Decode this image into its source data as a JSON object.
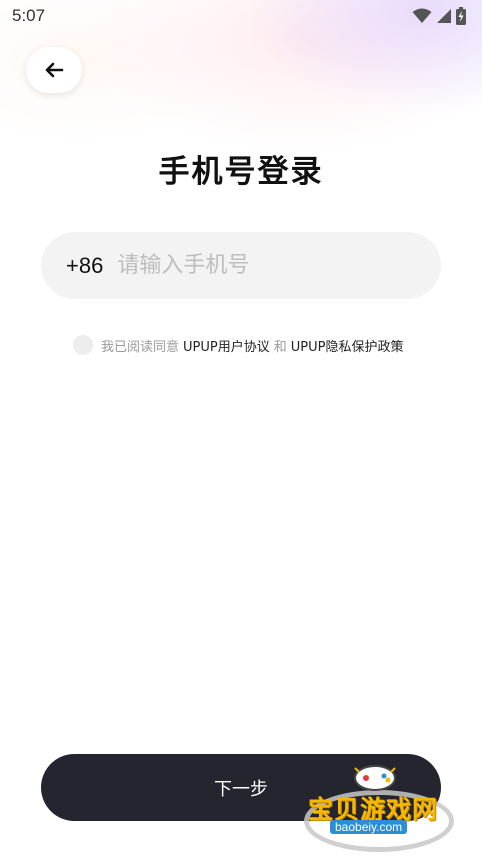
{
  "status_bar": {
    "time": "5:07",
    "icons": [
      "wifi-icon",
      "signal-icon",
      "battery-charging-icon"
    ]
  },
  "header": {
    "back_icon": "arrow-left-icon"
  },
  "login": {
    "title": "手机号登录",
    "country_code": "+86",
    "phone_placeholder": "请输入手机号",
    "phone_value": ""
  },
  "agreement": {
    "checked": false,
    "prefix": "我已阅读同意",
    "user_agreement": "UPUP用户协议",
    "and": "和",
    "privacy_policy": "UPUP隐私保护政策"
  },
  "actions": {
    "next_label": "下一步"
  },
  "watermark": {
    "title": "宝贝游戏网",
    "url": "baobeiy.com"
  },
  "colors": {
    "button_bg": "#25252f",
    "field_bg": "#f3f3f3",
    "muted_text": "#9a9a9a",
    "watermark_gold": "#f5b800",
    "watermark_blue": "#2a8fd6"
  }
}
